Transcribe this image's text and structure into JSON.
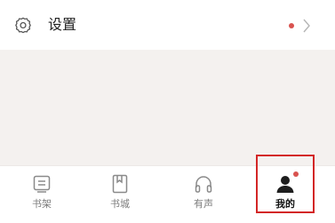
{
  "settings": {
    "label": "设置",
    "icon": "gear-icon",
    "has_notification": true,
    "chevron": "chevron-right-icon"
  },
  "tabbar": {
    "items": [
      {
        "label": "书架",
        "icon": "bookshelf-icon",
        "active": false
      },
      {
        "label": "书城",
        "icon": "bookstore-icon",
        "active": false
      },
      {
        "label": "有声",
        "icon": "headphones-icon",
        "active": false
      },
      {
        "label": "我的",
        "icon": "user-icon",
        "active": true,
        "has_notification": true
      }
    ]
  },
  "colors": {
    "accent_red": "#d9534f",
    "highlight_border": "#d32626",
    "background_grey": "#f4f1ef",
    "label_grey": "#7c7c7c"
  }
}
